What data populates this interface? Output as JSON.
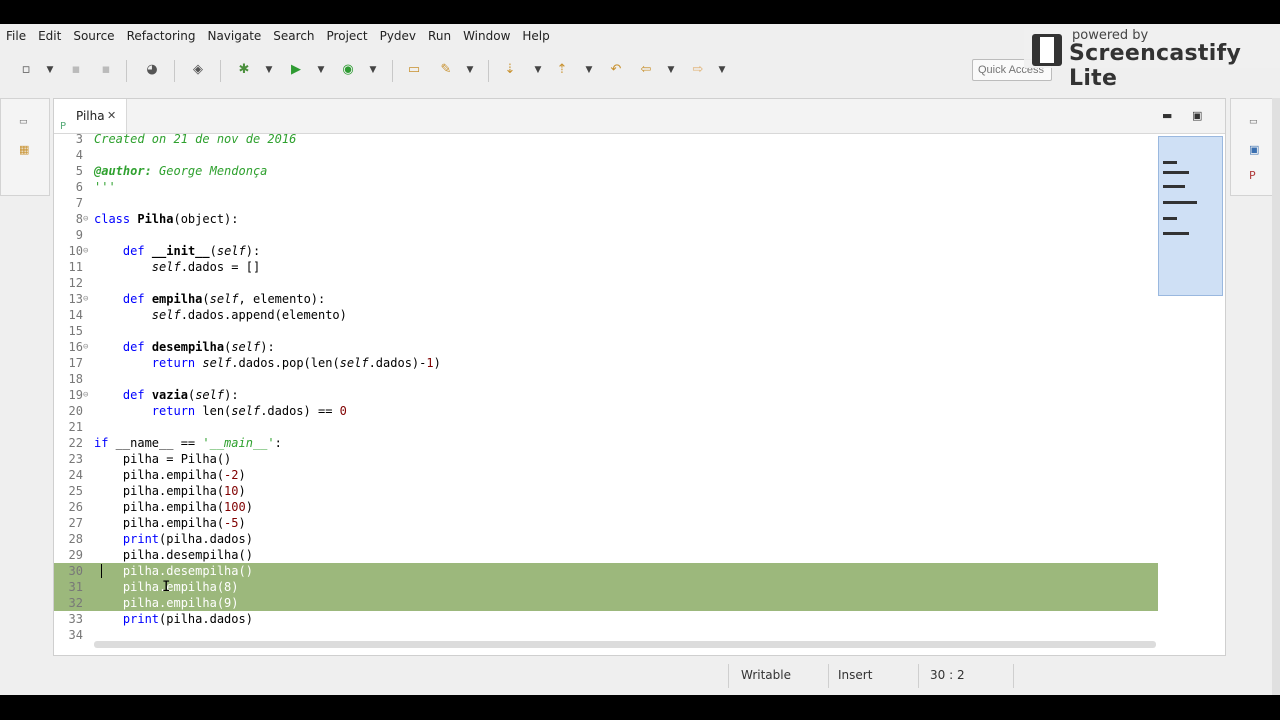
{
  "menu": [
    "File",
    "Edit",
    "Source",
    "Refactoring",
    "Navigate",
    "Search",
    "Project",
    "Pydev",
    "Run",
    "Window",
    "Help"
  ],
  "quick_access": {
    "placeholder": "Quick Access"
  },
  "watermark": {
    "small": "powered by",
    "big": "Screencastify Lite"
  },
  "editor": {
    "tab_label": "Pilha"
  },
  "code_lines": [
    {
      "n": "3",
      "fold": "",
      "html": "<span class=\"cm\">Created on 21 de nov de 2016</span>"
    },
    {
      "n": "4",
      "fold": "",
      "html": ""
    },
    {
      "n": "5",
      "fold": "",
      "html": "<span class=\"cm\"><b>@author:</b> George Mendonça</span>"
    },
    {
      "n": "6",
      "fold": "",
      "html": "<span class=\"str\">'''</span>"
    },
    {
      "n": "7",
      "fold": "",
      "html": ""
    },
    {
      "n": "8",
      "fold": "⊖",
      "html": "<span class=\"kw\">class</span> <span class=\"b\">Pilha</span>(object):"
    },
    {
      "n": "9",
      "fold": "",
      "html": ""
    },
    {
      "n": "10",
      "fold": "⊖",
      "html": "    <span class=\"kw\">def</span> <span class=\"b\">__init__</span>(<span class=\"it\">self</span>):"
    },
    {
      "n": "11",
      "fold": "",
      "html": "        <span class=\"it\">self</span>.dados = []"
    },
    {
      "n": "12",
      "fold": "",
      "html": ""
    },
    {
      "n": "13",
      "fold": "⊖",
      "html": "    <span class=\"kw\">def</span> <span class=\"b\">empilha</span>(<span class=\"it\">self</span>, elemento):"
    },
    {
      "n": "14",
      "fold": "",
      "html": "        <span class=\"it\">self</span>.dados.append(elemento)"
    },
    {
      "n": "15",
      "fold": "",
      "html": ""
    },
    {
      "n": "16",
      "fold": "⊖",
      "html": "    <span class=\"kw\">def</span> <span class=\"b\">desempilha</span>(<span class=\"it\">self</span>):"
    },
    {
      "n": "17",
      "fold": "",
      "html": "        <span class=\"kw\">return</span> <span class=\"it\">self</span>.dados.pop(len(<span class=\"it\">self</span>.dados)-<span class=\"num\">1</span>)"
    },
    {
      "n": "18",
      "fold": "",
      "html": ""
    },
    {
      "n": "19",
      "fold": "⊖",
      "html": "    <span class=\"kw\">def</span> <span class=\"b\">vazia</span>(<span class=\"it\">self</span>):"
    },
    {
      "n": "20",
      "fold": "",
      "html": "        <span class=\"kw\">return</span> len(<span class=\"it\">self</span>.dados) == <span class=\"num\">0</span>"
    },
    {
      "n": "21",
      "fold": "",
      "html": ""
    },
    {
      "n": "22",
      "fold": "",
      "html": "<span class=\"kw\">if</span> __name__ == <span class=\"str\">'<i>__main__</i>'</span>:"
    },
    {
      "n": "23",
      "fold": "",
      "html": "    pilha = Pilha()"
    },
    {
      "n": "24",
      "fold": "",
      "html": "    pilha.empilha(<span class=\"num\">-2</span>)"
    },
    {
      "n": "25",
      "fold": "",
      "html": "    pilha.empilha(<span class=\"num\">10</span>)"
    },
    {
      "n": "26",
      "fold": "",
      "html": "    pilha.empilha(<span class=\"num\">100</span>)"
    },
    {
      "n": "27",
      "fold": "",
      "html": "    pilha.empilha(<span class=\"num\">-5</span>)"
    },
    {
      "n": "28",
      "fold": "",
      "html": "    <span class=\"kw\">print</span>(pilha.dados)"
    },
    {
      "n": "29",
      "fold": "",
      "html": "    pilha.desempilha()"
    },
    {
      "n": "30",
      "fold": "",
      "html": "    pilha.desempilha()",
      "sel": true
    },
    {
      "n": "31",
      "fold": "",
      "html": "    pilha.empilha(8)",
      "sel": true
    },
    {
      "n": "32",
      "fold": "",
      "html": "    pilha.empilha(9)",
      "sel": true
    },
    {
      "n": "33",
      "fold": "",
      "html": "    <span class=\"kw\">print</span>(pilha.dados)"
    },
    {
      "n": "34",
      "fold": "",
      "html": ""
    }
  ],
  "status": {
    "writable": "Writable",
    "insert_mode": "Insert",
    "position": "30 : 2"
  },
  "colors": {
    "selection": "#9cb87c",
    "keyword": "#0000ff",
    "comment": "#2fa12f",
    "number": "#800000"
  }
}
